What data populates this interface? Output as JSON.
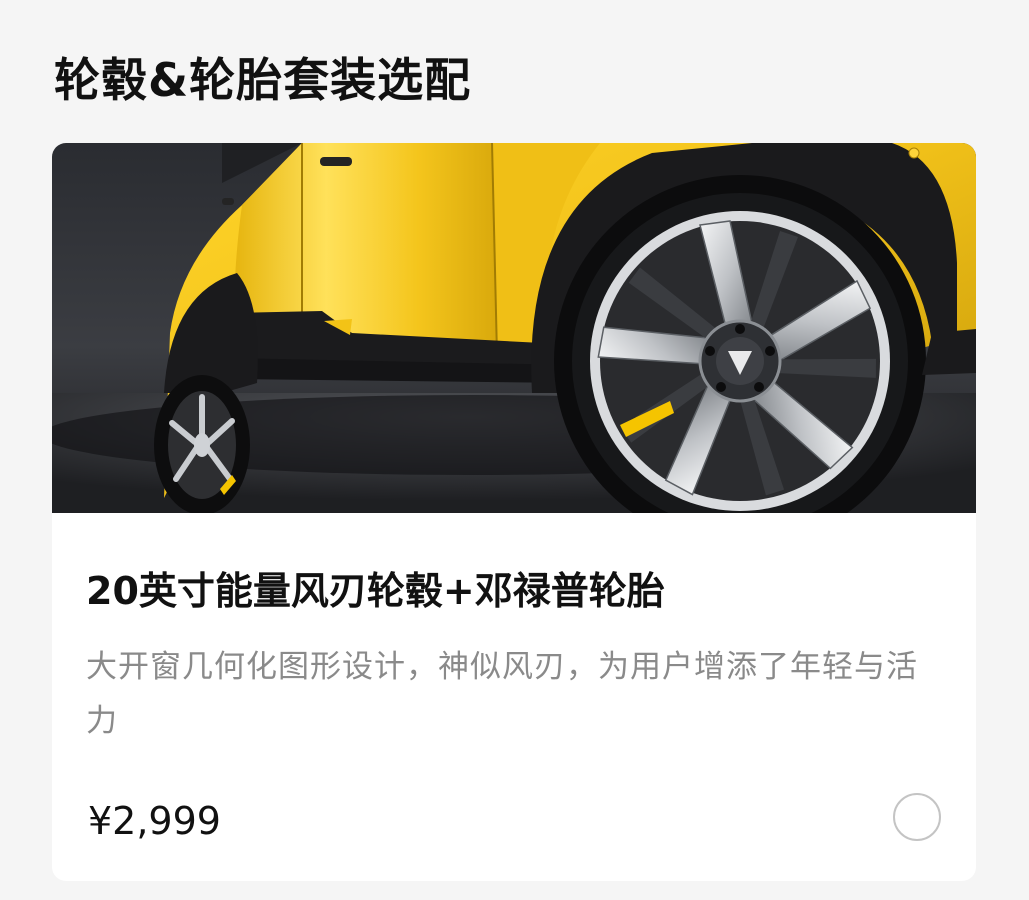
{
  "section": {
    "title": "轮毂&轮胎套装选配"
  },
  "option": {
    "image_description": "Yellow car side view with 20-inch multi-spoke wheel",
    "title": "20英寸能量风刃轮毂+邓禄普轮胎",
    "description": "大开窗几何化图形设计，神似风刃，为用户增添了年轻与活力",
    "price": "¥2,999",
    "selected": false
  },
  "colors": {
    "page_background": "#f5f5f5",
    "card_background": "#ffffff",
    "title_text": "#111111",
    "description_text": "#8a8a8a",
    "radio_border": "#c4c4c4",
    "car_body": "#f2c21a",
    "wheel_accent": "#f5c400"
  }
}
